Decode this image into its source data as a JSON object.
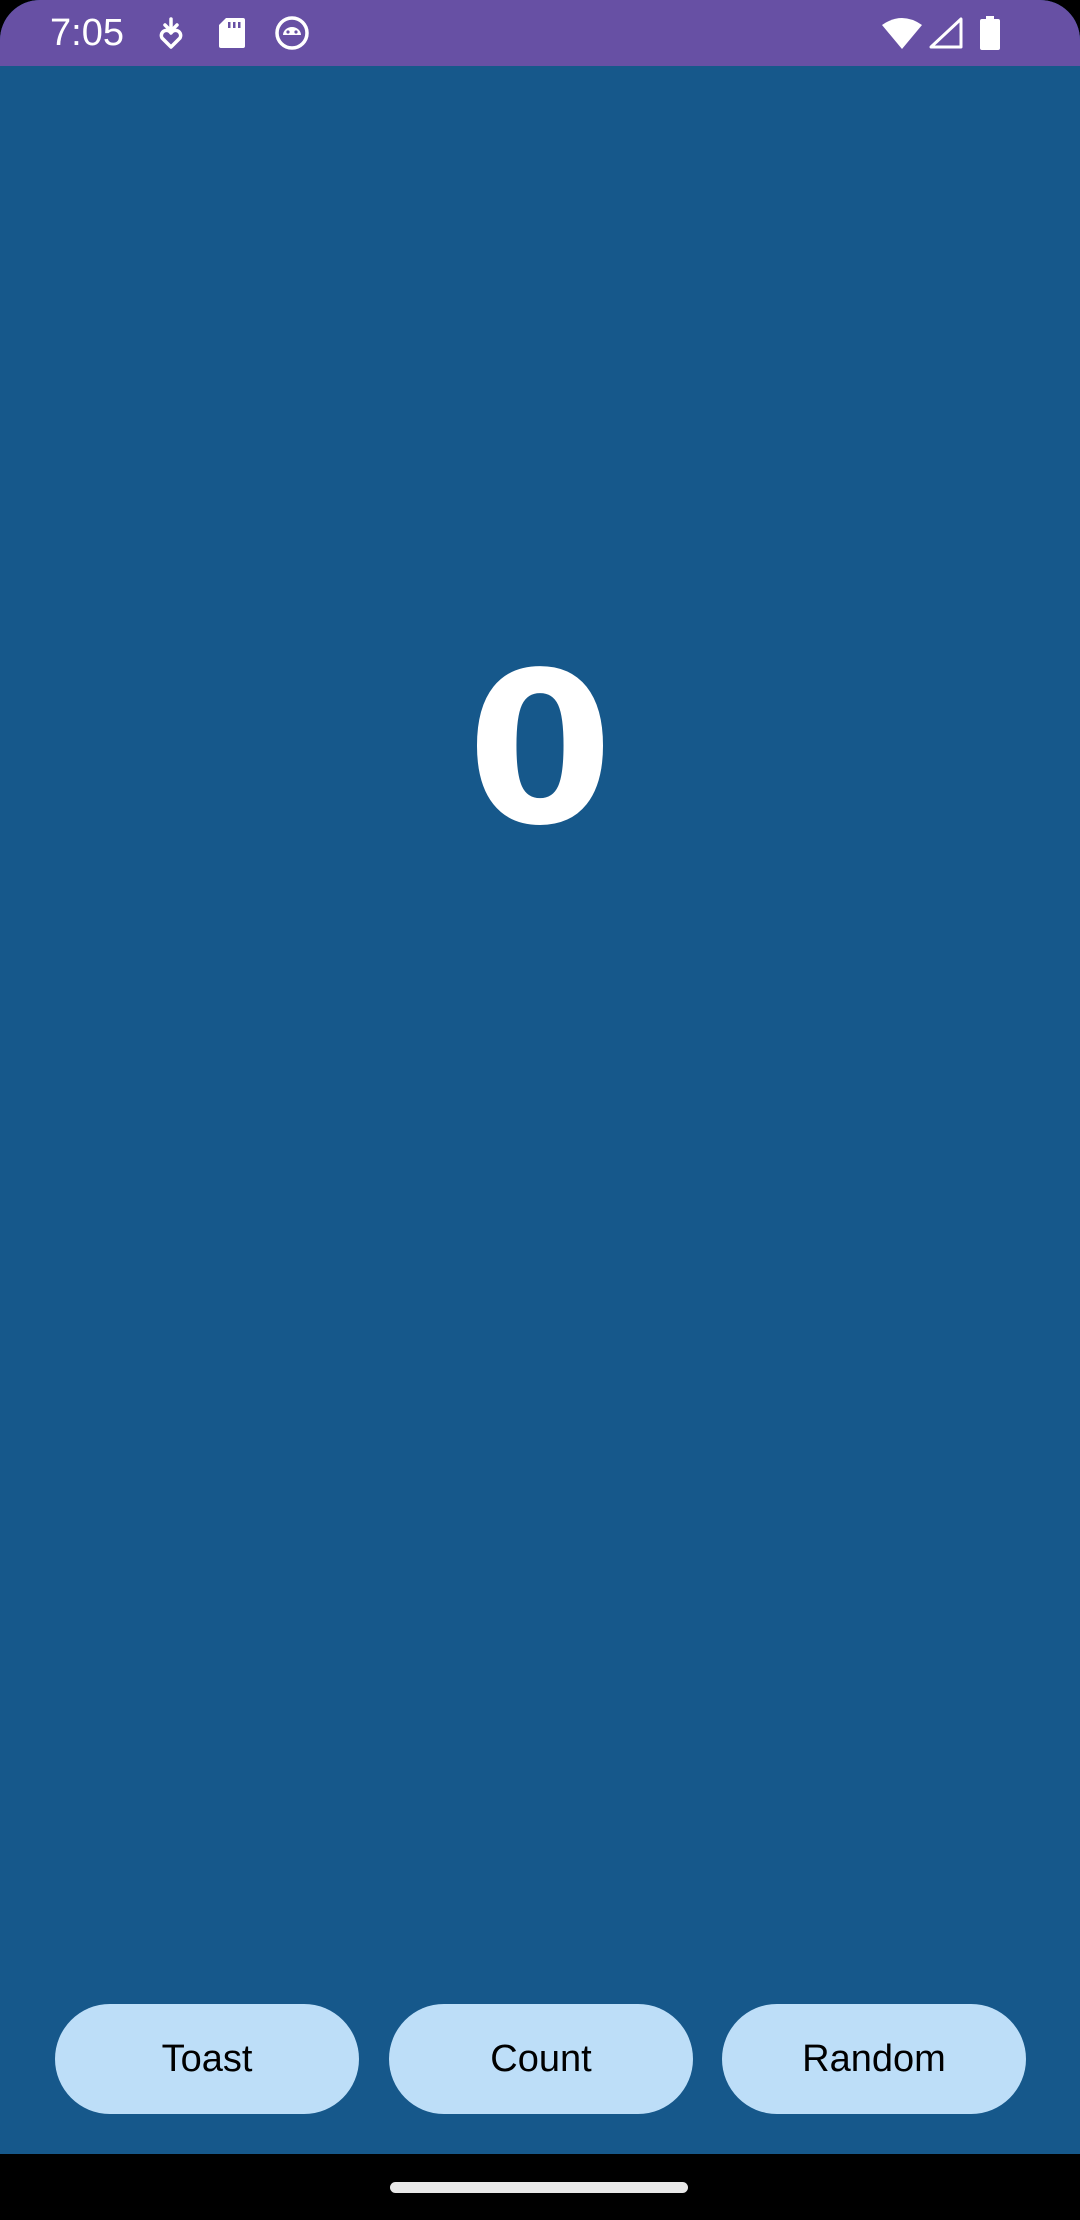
{
  "status_bar": {
    "time": "7:05",
    "background_color": "#6750A4",
    "left_icons": [
      "download-heart-icon",
      "sd-card-icon",
      "android-face-icon"
    ],
    "right_icons": [
      "wifi-icon",
      "cell-signal-icon",
      "battery-icon"
    ]
  },
  "main": {
    "background_color": "#16588B",
    "counter_value": "0"
  },
  "buttons": {
    "toast_label": "Toast",
    "count_label": "Count",
    "random_label": "Random",
    "button_color": "#BDDEF8"
  },
  "nav_bar": {
    "handle": "home-gesture-handle"
  }
}
